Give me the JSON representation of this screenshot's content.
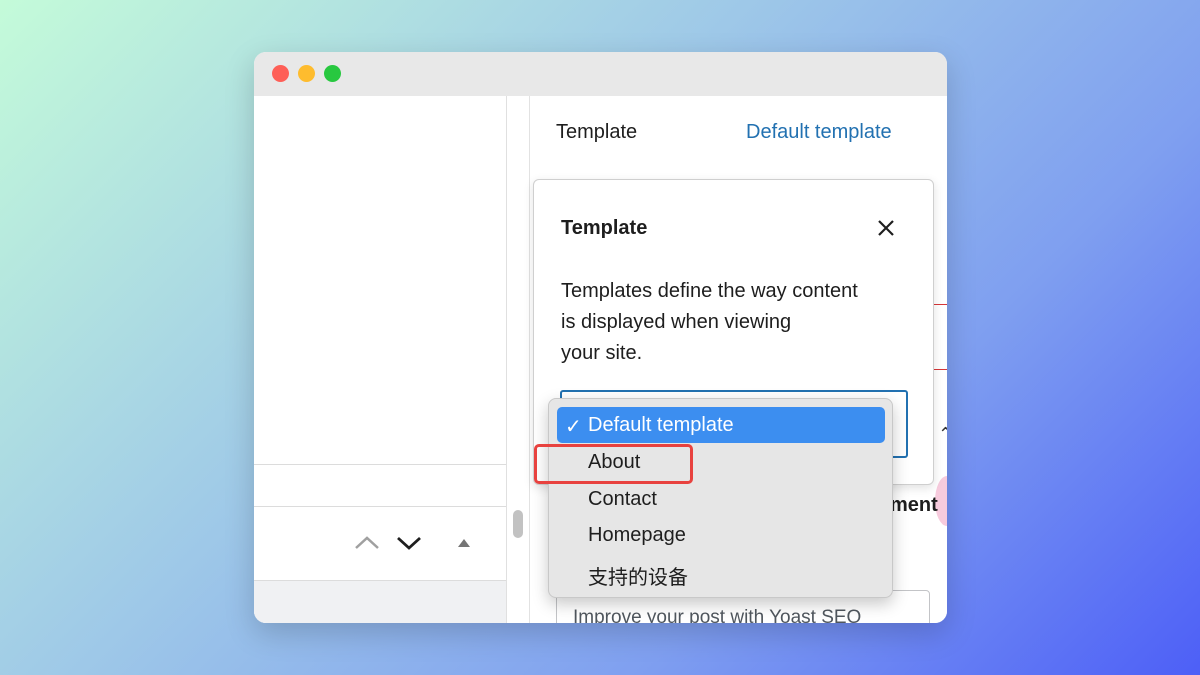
{
  "sidebar": {
    "template_label": "Template",
    "template_value": "Default template",
    "partial_heading": "ment",
    "yoast_text": "Improve your post with Yoast SEO"
  },
  "popover": {
    "title": "Template",
    "description_lines": [
      "Templates define the way content",
      "is displayed when viewing",
      "your site."
    ]
  },
  "dropdown": {
    "options": [
      {
        "label": "Default template",
        "selected": true,
        "check": "✓"
      },
      {
        "label": "About",
        "selected": false
      },
      {
        "label": "Contact",
        "selected": false
      },
      {
        "label": "Homepage",
        "selected": false
      },
      {
        "label": "支持的设备",
        "selected": false
      }
    ]
  },
  "colors": {
    "accent": "#2271b1",
    "menu_selected": "#3c8ef0",
    "highlight": "#e8423f"
  },
  "icons": {
    "close": "close-icon",
    "up": "chevron-up-icon",
    "down": "chevron-down-icon",
    "triangle": "triangle-up-icon"
  }
}
